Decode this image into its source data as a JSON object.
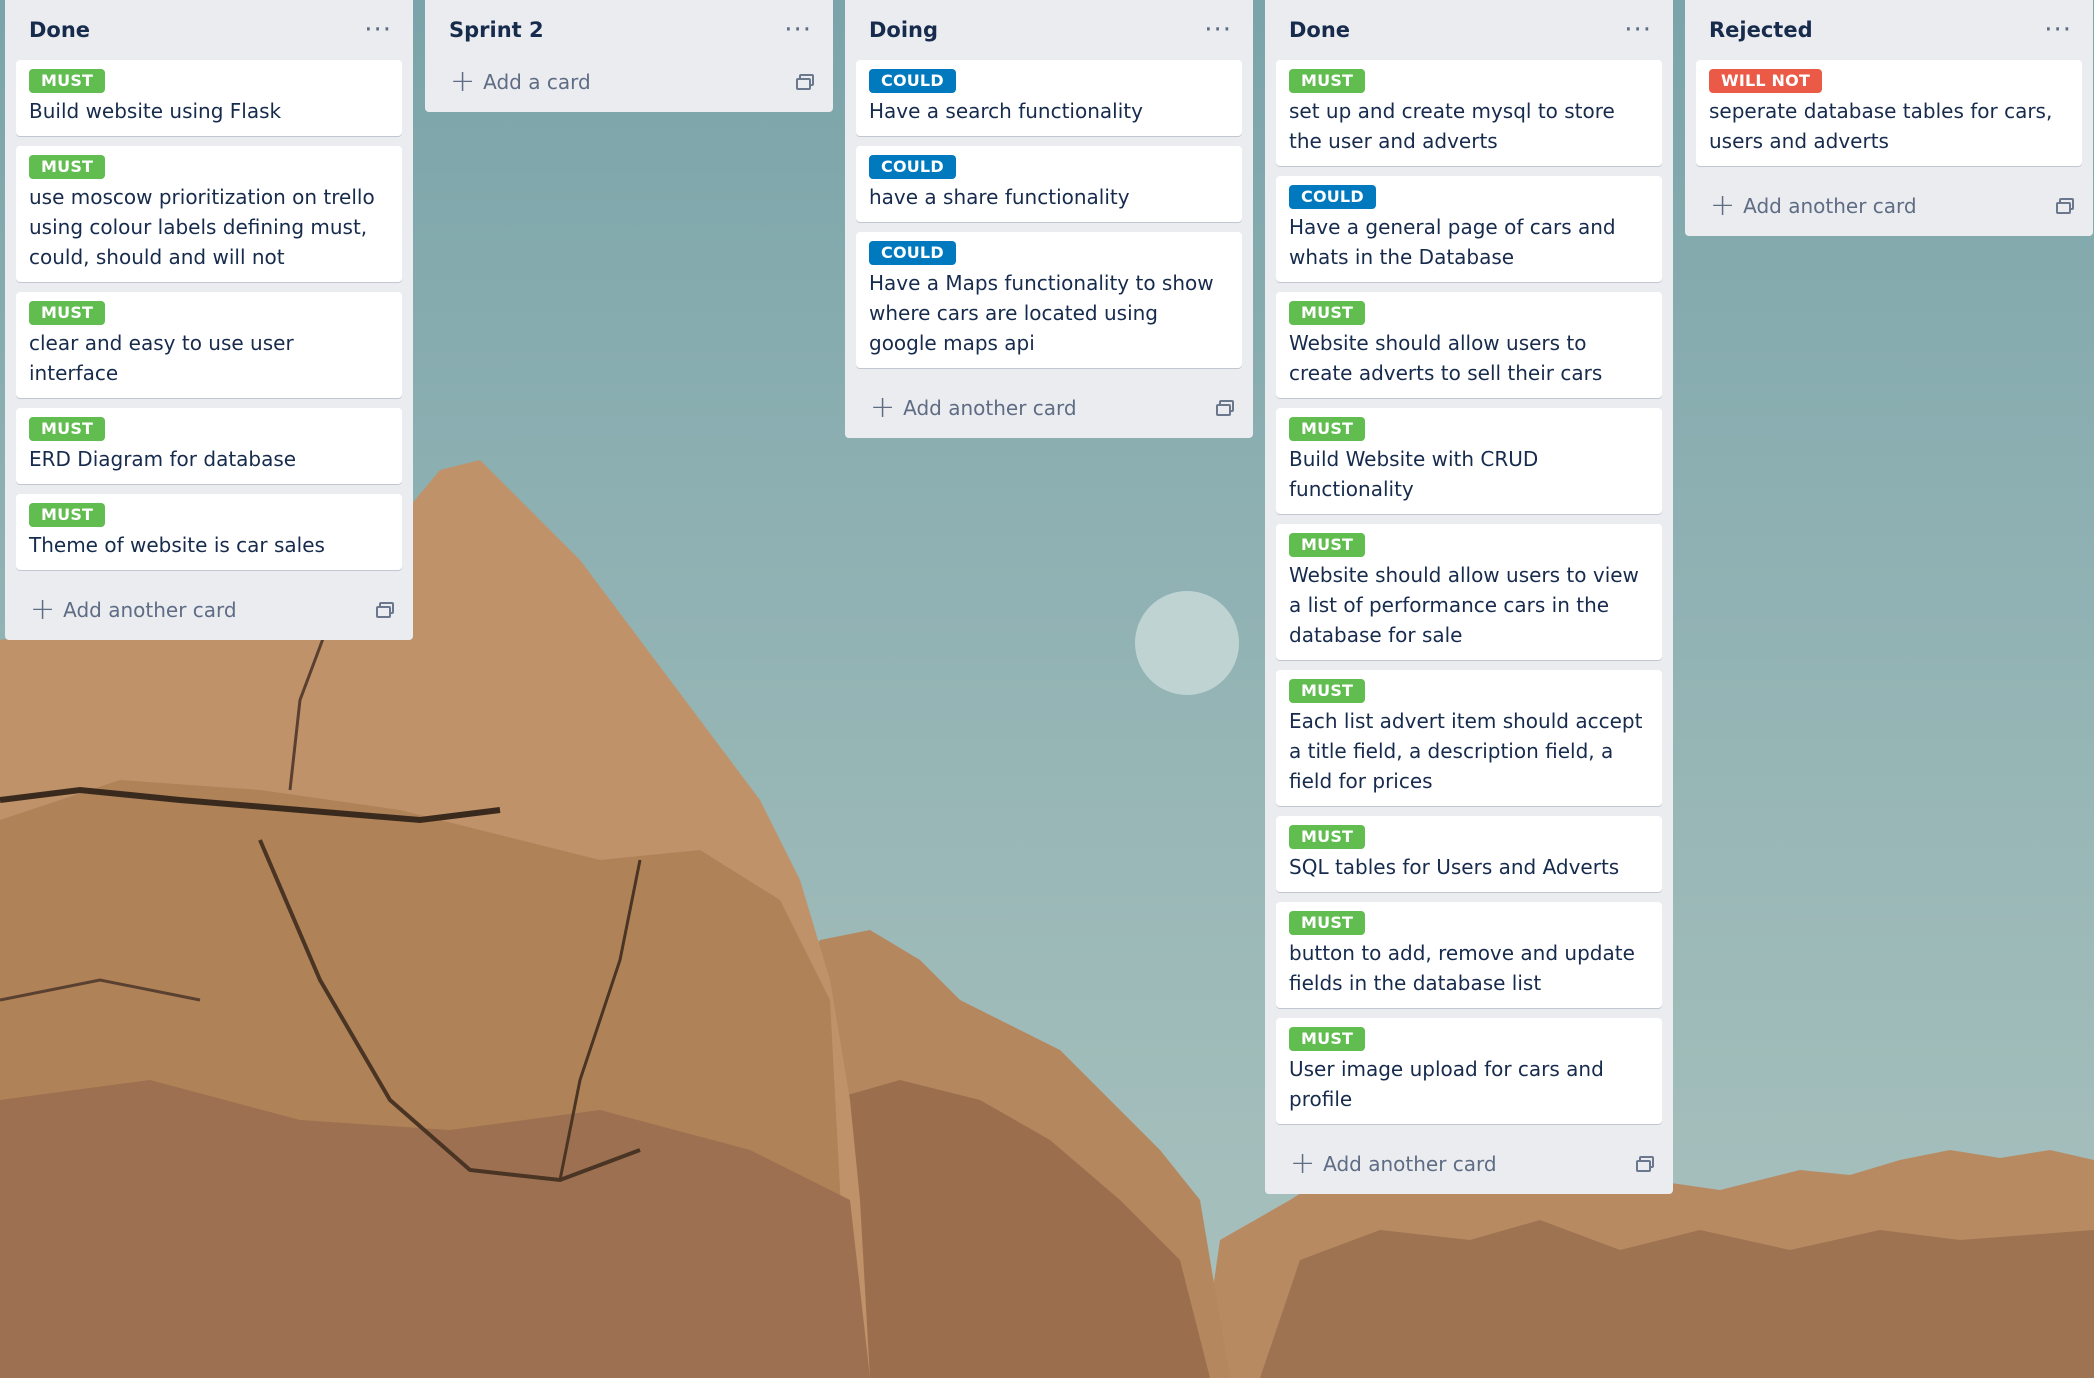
{
  "lists": [
    {
      "title": "Done",
      "add_label": "Add another card",
      "cards": [
        {
          "label": "MUST",
          "title": "Build website using Flask"
        },
        {
          "label": "MUST",
          "title": "use moscow prioritization on trello using colour labels defining must, could, should and will not"
        },
        {
          "label": "MUST",
          "title": "clear and easy to use user interface"
        },
        {
          "label": "MUST",
          "title": "ERD Diagram for database"
        },
        {
          "label": "MUST",
          "title": "Theme of website is car sales"
        }
      ]
    },
    {
      "title": "Sprint 2",
      "add_label": "Add a card",
      "cards": []
    },
    {
      "title": "Doing",
      "add_label": "Add another card",
      "cards": [
        {
          "label": "COULD",
          "title": "Have a search functionality"
        },
        {
          "label": "COULD",
          "title": "have a share functionality"
        },
        {
          "label": "COULD",
          "title": "Have a Maps functionality to show where cars are located using google maps api"
        }
      ]
    },
    {
      "title": "Done",
      "add_label": "Add another card",
      "cards": [
        {
          "label": "MUST",
          "title": "set up and create mysql to store the user and adverts"
        },
        {
          "label": "COULD",
          "title": "Have a general page of cars and whats in the Database"
        },
        {
          "label": "MUST",
          "title": "Website should allow users to create adverts to sell their cars"
        },
        {
          "label": "MUST",
          "title": "Build Website with CRUD functionality"
        },
        {
          "label": "MUST",
          "title": "Website should allow users to view a list of performance cars in the database for sale"
        },
        {
          "label": "MUST",
          "title": "Each list advert item should accept a title field, a description field, a field for prices"
        },
        {
          "label": "MUST",
          "title": "SQL tables for Users and Adverts"
        },
        {
          "label": "MUST",
          "title": "button to add, remove and update fields in the database list"
        },
        {
          "label": "MUST",
          "title": "User image upload for cars and profile"
        }
      ]
    },
    {
      "title": "Rejected",
      "add_label": "Add another card",
      "cards": [
        {
          "label": "WILL NOT",
          "title": "seperate database tables for cars, users and adverts"
        }
      ]
    }
  ],
  "menu_glyph": "···",
  "plus_glyph": "+",
  "colors": {
    "must": "#61bd4f",
    "could": "#0079bf",
    "will_not": "#eb5a46",
    "list_bg": "#ebecf0"
  }
}
